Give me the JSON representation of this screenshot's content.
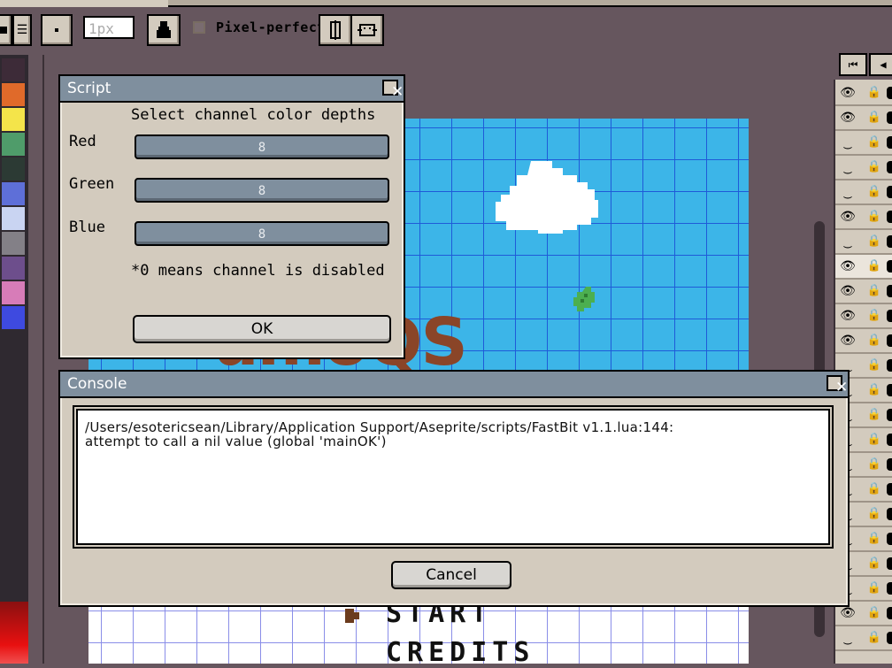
{
  "toolbar": {
    "brush_size_placeholder": "1px",
    "pixel_perfect_label": "Pixel-perfect"
  },
  "palette": {
    "colors": [
      "#3d2b38",
      "#e06a2a",
      "#f4e44a",
      "#4f9c6a",
      "#2c3a34",
      "#5e6fd8",
      "#c9d4f2",
      "#838087",
      "#6d4e8c",
      "#d77cb8",
      "#3e4ae0"
    ]
  },
  "canvas": {
    "logo_text": "umoQS",
    "menu": {
      "start": "START",
      "credits": "CREDITS"
    }
  },
  "script_dialog": {
    "title": "Script",
    "heading": "Select channel color depths",
    "channels": [
      {
        "label": "Red",
        "value": "8"
      },
      {
        "label": "Green",
        "value": "8"
      },
      {
        "label": "Blue",
        "value": "8"
      }
    ],
    "note": "*0 means channel is disabled",
    "ok_label": "OK"
  },
  "console_dialog": {
    "title": "Console",
    "line1": "/Users/esotericsean/Library/Application Support/Aseprite/scripts/FastBit v1.1.lua:144:",
    "line2": "attempt to call a nil value (global 'mainOK')",
    "cancel_label": "Cancel"
  }
}
